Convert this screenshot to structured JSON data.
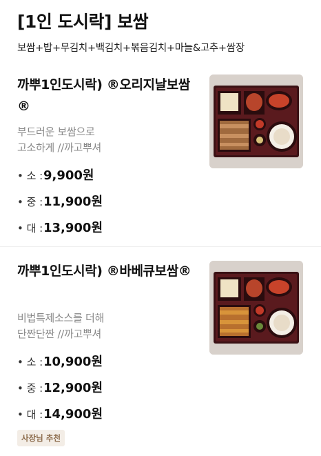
{
  "category": {
    "title": "[1인 도시락] 보쌈",
    "description": "보쌈+밥+무김치+백김치+볶음김치+마늘&고추+쌈장"
  },
  "items": [
    {
      "name": "까뿌1인도시락) ®오리지날보쌈®",
      "description_line1": "부드러운 보쌈으로",
      "description_line2": "고소하게 //까고뿌셔",
      "prices": [
        {
          "size": "• 소 :",
          "price": "9,900원"
        },
        {
          "size": "• 중 :",
          "price": "11,900원"
        },
        {
          "size": "• 대 :",
          "price": "13,900원"
        }
      ]
    },
    {
      "name": "까뿌1인도시락) ®바베큐보쌈®",
      "description_line1": "비법특제소스를 더해",
      "description_line2": "단짠단짠 //까고뿌셔",
      "prices": [
        {
          "size": "• 소 :",
          "price": "10,900원"
        },
        {
          "size": "• 중 :",
          "price": "12,900원"
        },
        {
          "size": "• 대 :",
          "price": "14,900원"
        }
      ],
      "badge": "사장님 추천"
    }
  ],
  "colors": {
    "accent_badge_bg": "#f3ede6",
    "accent_badge_text": "#8b6a4a",
    "muted_text": "#8a8a8a"
  }
}
